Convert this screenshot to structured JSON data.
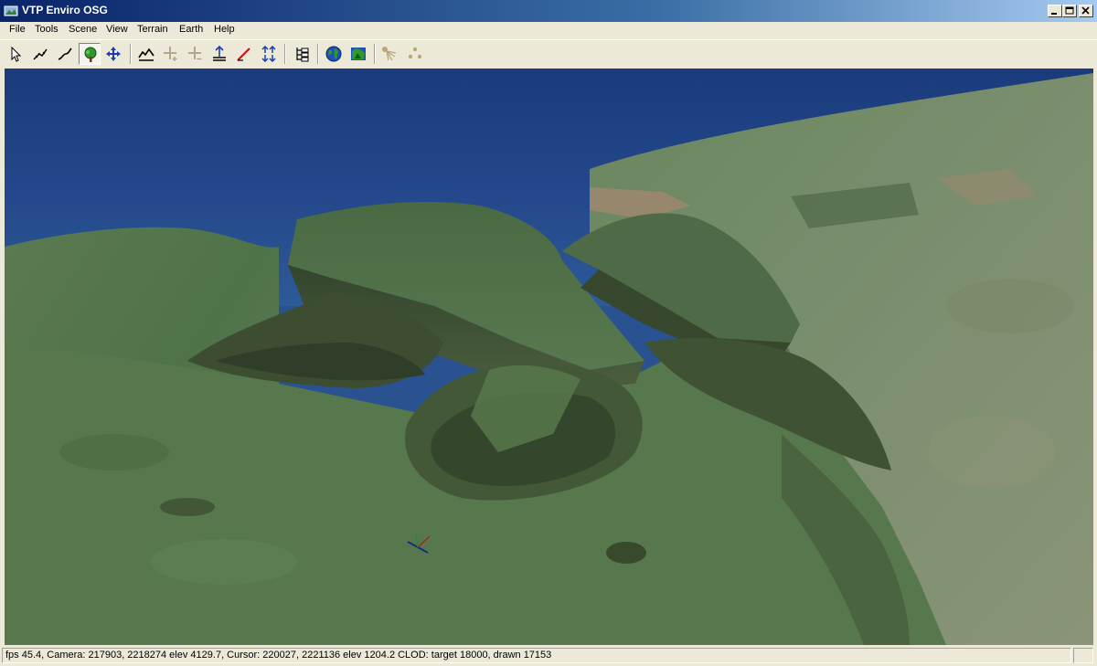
{
  "window": {
    "title": "VTP Enviro OSG"
  },
  "menu": {
    "items": [
      "File",
      "Tools",
      "Scene",
      "View",
      "Terrain",
      "Earth",
      "Help"
    ]
  },
  "toolbar": {
    "buttons": [
      {
        "icon": "pointer-icon",
        "active": false
      },
      {
        "icon": "measure-path-icon",
        "active": false
      },
      {
        "icon": "route-line-icon",
        "active": false
      },
      {
        "icon": "tree-icon",
        "active": true
      },
      {
        "icon": "move-icon",
        "active": false
      },
      {
        "icon": "terrain-profile-icon",
        "active": false
      },
      {
        "icon": "speed-up-icon",
        "active": false
      },
      {
        "icon": "speed-down-icon",
        "active": false
      },
      {
        "icon": "elevation-icon",
        "active": false
      },
      {
        "icon": "slope-tool-icon",
        "active": false
      },
      {
        "icon": "navigate-icon",
        "active": false
      },
      {
        "icon": "scene-graph-icon",
        "active": false
      },
      {
        "icon": "globe-icon",
        "active": false
      },
      {
        "icon": "terrain-map-icon",
        "active": false
      },
      {
        "icon": "sun-rays-icon",
        "active": false
      },
      {
        "icon": "dots-icon",
        "active": false
      }
    ]
  },
  "status": {
    "text": "fps 45.4, Camera:  217903, 2218274 elev 4129.7, Cursor:  220027, 2221136 elev 1204.2 CLOD: target 18000, drawn 17153"
  },
  "colors": {
    "title_start": "#0a246a",
    "title_end": "#a6caf0",
    "sea": "#22498a",
    "terrain": "#5a7a4e",
    "cliff": "#3b4a2e"
  }
}
